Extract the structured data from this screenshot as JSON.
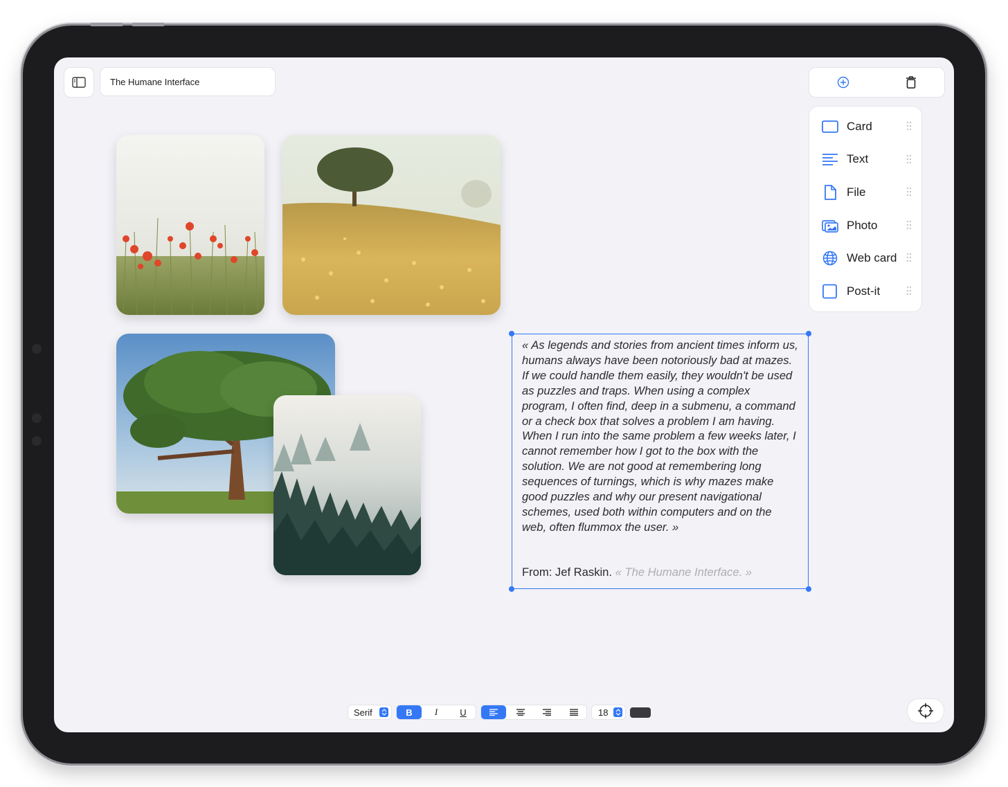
{
  "header": {
    "document_title": "The Humane Interface"
  },
  "palette": {
    "items": [
      {
        "label": "Card",
        "icon": "card-icon"
      },
      {
        "label": "Text",
        "icon": "text-lines-icon"
      },
      {
        "label": "File",
        "icon": "file-icon"
      },
      {
        "label": "Photo",
        "icon": "photo-icon"
      },
      {
        "label": "Web card",
        "icon": "globe-icon"
      },
      {
        "label": "Post-it",
        "icon": "postit-icon"
      }
    ]
  },
  "text_card": {
    "quote": "« As legends and stories from ancient times inform us, humans always have been notoriously bad at mazes. If we could handle them easily, they wouldn't be used as puzzles and traps. When using a complex program, I often find, deep in a submenu, a command or a check box that solves a problem I am having. When I run into the same problem a few weeks later, I cannot remember how I got to the box with the solution. We are not good at remembering long sequences of turnings, which is why mazes make good puzzles and why our present navigational schemes, used both within computers and on the web, often flummox the user. »",
    "source_prefix": "From: Jef Raskin.",
    "source_book": "« The Humane Interface. »"
  },
  "format_toolbar": {
    "font": "Serif",
    "bold": "B",
    "italic": "I",
    "underline": "U",
    "font_size": "18",
    "bold_active": true,
    "align_active": "left",
    "text_color": "#3a3a3c"
  },
  "colors": {
    "accent": "#3478f6",
    "canvas": "#f2f2f7"
  }
}
